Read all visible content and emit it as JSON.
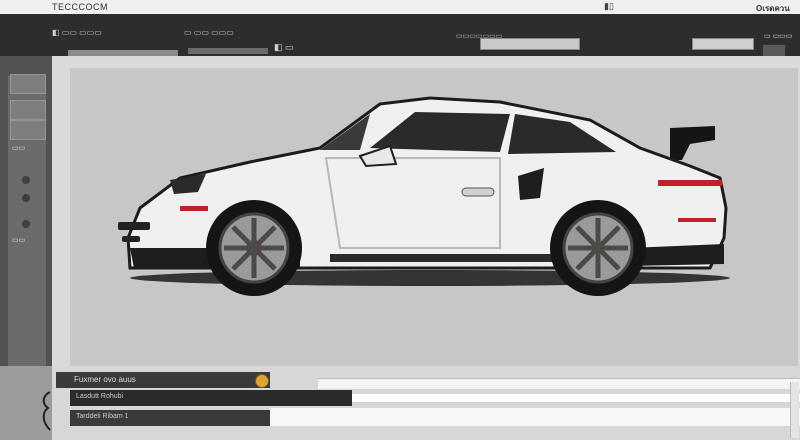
{
  "window": {
    "title": "TECCCOCM",
    "mid_text": "▮▯",
    "right_text": "Oเรดควน"
  },
  "menubar": {
    "item1": "◧ ▭▭ ▭▭▭",
    "item2": "▭ ▭▭ ▭▭▭",
    "item3": "◧ ▭",
    "field_label": "▭▭▭▭▭▭▭",
    "right_label": "▭ ▭▭▭"
  },
  "sidebar": {
    "labels": [
      "▭▭",
      "▭▭",
      "▭",
      "▭▭"
    ]
  },
  "bottom": {
    "row1": "Fuxmer ovo auus",
    "row2": "Lasdutt Rohubi",
    "row3": "Tarddeli Ribam 1"
  },
  "colors": {
    "accent_orange": "#d9a43a",
    "dark_ui": "#2d2d2d",
    "car_body": "#f2f2f2",
    "car_trim": "#c0202a"
  }
}
